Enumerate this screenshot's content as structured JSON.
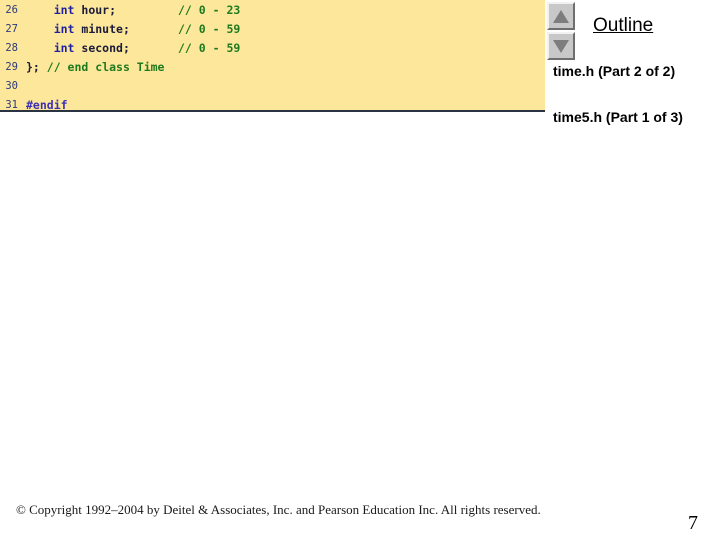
{
  "code_block": {
    "language": "cpp",
    "background_color": "#fde79a",
    "lines": [
      {
        "number": "26",
        "tokens": [
          {
            "text": "    ",
            "kind": "plain"
          },
          {
            "text": "int",
            "kind": "kw"
          },
          {
            "text": " hour;",
            "kind": "ident"
          }
        ],
        "comment": "// 0 - 23"
      },
      {
        "number": "27",
        "tokens": [
          {
            "text": "    ",
            "kind": "plain"
          },
          {
            "text": "int",
            "kind": "kw"
          },
          {
            "text": " minute;",
            "kind": "ident"
          }
        ],
        "comment": "// 0 - 59"
      },
      {
        "number": "28",
        "tokens": [
          {
            "text": "    ",
            "kind": "plain"
          },
          {
            "text": "int",
            "kind": "kw"
          },
          {
            "text": " second;",
            "kind": "ident"
          }
        ],
        "comment": "// 0 - 59"
      },
      {
        "number": "29",
        "tokens": [
          {
            "text": "}; ",
            "kind": "punct"
          },
          {
            "text": "// end class Time",
            "kind": "comment"
          }
        ],
        "comment": ""
      },
      {
        "number": "30",
        "tokens": [],
        "comment": ""
      },
      {
        "number": "31",
        "tokens": [
          {
            "text": "#endif",
            "kind": "pre"
          }
        ],
        "comment": ""
      }
    ]
  },
  "outline": {
    "title": "Outline",
    "up_icon": "triangle-up-icon",
    "down_icon": "triangle-down-icon",
    "items": [
      {
        "label": "time.h (Part 2 of 2)"
      },
      {
        "label": "time5.h (Part 1 of 3)"
      }
    ]
  },
  "footer": {
    "copyright": "© Copyright 1992–2004 by Deitel & Associates, Inc. and Pearson Education Inc. All rights reserved.",
    "page_number": "7"
  }
}
